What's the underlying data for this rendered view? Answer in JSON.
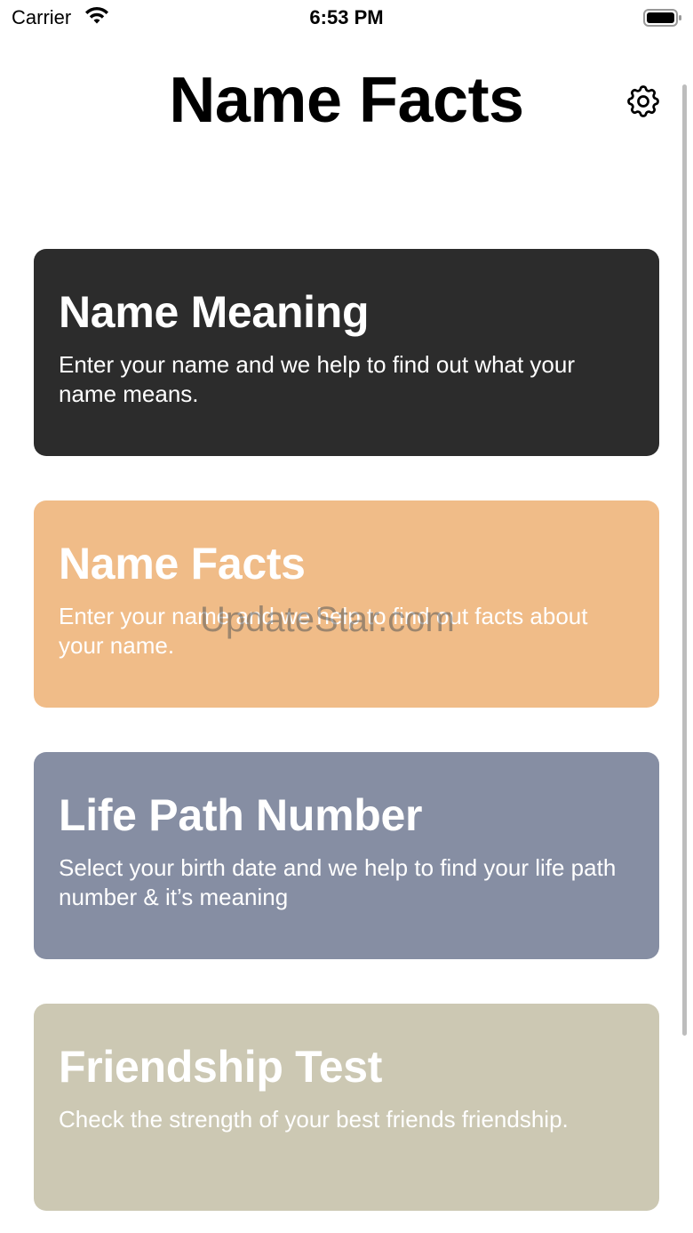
{
  "status_bar": {
    "carrier": "Carrier",
    "time": "6:53 PM",
    "wifi_icon": "wifi-icon",
    "battery_icon": "battery-full-icon"
  },
  "header": {
    "title": "Name Facts",
    "settings_icon": "gear-icon"
  },
  "cards": [
    {
      "title": "Name Meaning",
      "description": "Enter your name and we help to find out what your name means.",
      "color": "#2c2c2c"
    },
    {
      "title": "Name Facts",
      "description": "Enter your name and we help to find out facts about your name.",
      "color": "#f0bc88"
    },
    {
      "title": "Life Path Number",
      "description": "Select your birth date and we help to find your life path number & it’s meaning",
      "color": "#868ea3"
    },
    {
      "title": "Friendship Test",
      "description": "Check the strength of your best friends friendship.",
      "color": "#ccc8b3"
    }
  ],
  "watermark": "UpdateStar.com"
}
